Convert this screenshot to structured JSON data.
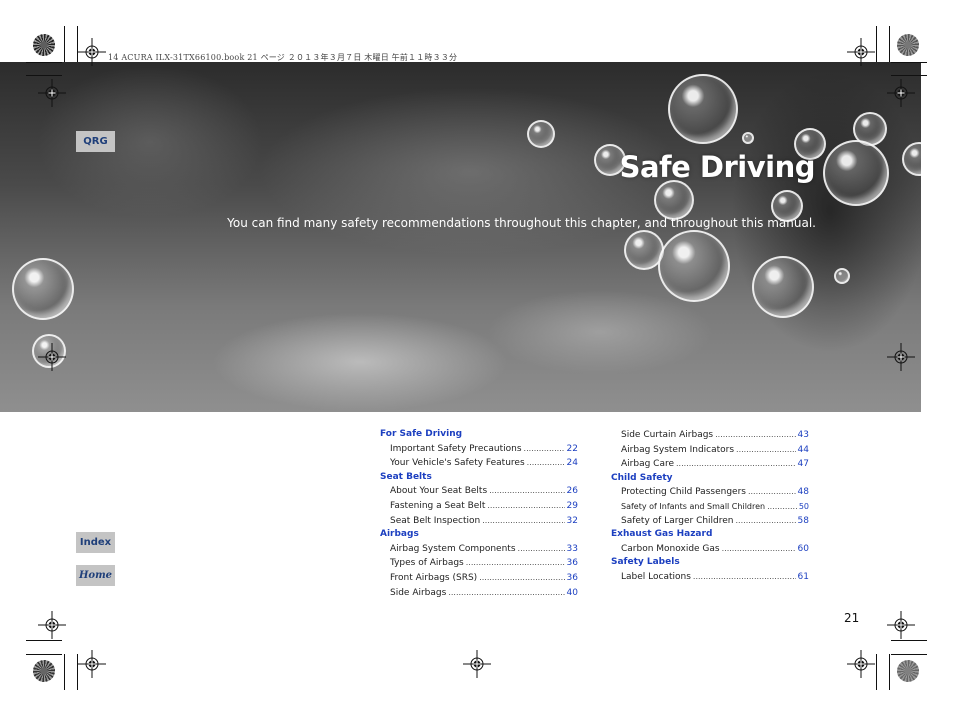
{
  "print_header": "14 ACURA ILX-31TX66100.book  21 ページ  ２０１３年３月７日  木曜日  午前１１時３３分",
  "banner": {
    "title": "Safe Driving",
    "intro": "You can find many safety recommendations throughout this chapter, and throughout this manual."
  },
  "nav": {
    "qrg_label": "QRG",
    "index_label": "Index",
    "home_label": "Home"
  },
  "toc": {
    "col1": [
      {
        "section": "For Safe Driving",
        "entries": [
          {
            "label": "Important Safety Precautions",
            "page": "22"
          },
          {
            "label": "Your Vehicle's Safety Features",
            "page": "24"
          }
        ]
      },
      {
        "section": "Seat Belts",
        "entries": [
          {
            "label": "About Your Seat Belts",
            "page": "26"
          },
          {
            "label": "Fastening a Seat Belt",
            "page": "29"
          },
          {
            "label": "Seat Belt Inspection",
            "page": "32"
          }
        ]
      },
      {
        "section": "Airbags",
        "entries": [
          {
            "label": "Airbag System Components",
            "page": "33"
          },
          {
            "label": "Types of Airbags",
            "page": "36"
          },
          {
            "label": "Front Airbags (SRS)",
            "page": "36"
          },
          {
            "label": "Side Airbags",
            "page": "40"
          }
        ]
      }
    ],
    "col2": [
      {
        "section": "",
        "entries": [
          {
            "label": "Side Curtain Airbags",
            "page": "43"
          },
          {
            "label": "Airbag System Indicators",
            "page": "44"
          },
          {
            "label": "Airbag Care",
            "page": "47"
          }
        ]
      },
      {
        "section": "Child Safety",
        "entries": [
          {
            "label": "Protecting Child Passengers",
            "page": "48"
          },
          {
            "label": "Safety of Infants and Small Children",
            "page": "50"
          },
          {
            "label": "Safety of Larger Children",
            "page": "58"
          }
        ]
      },
      {
        "section": "Exhaust Gas Hazard",
        "entries": [
          {
            "label": "Carbon Monoxide Gas",
            "page": "60"
          }
        ]
      },
      {
        "section": "Safety Labels",
        "entries": [
          {
            "label": "Label Locations",
            "page": "61"
          }
        ]
      }
    ]
  },
  "page_number": "21"
}
